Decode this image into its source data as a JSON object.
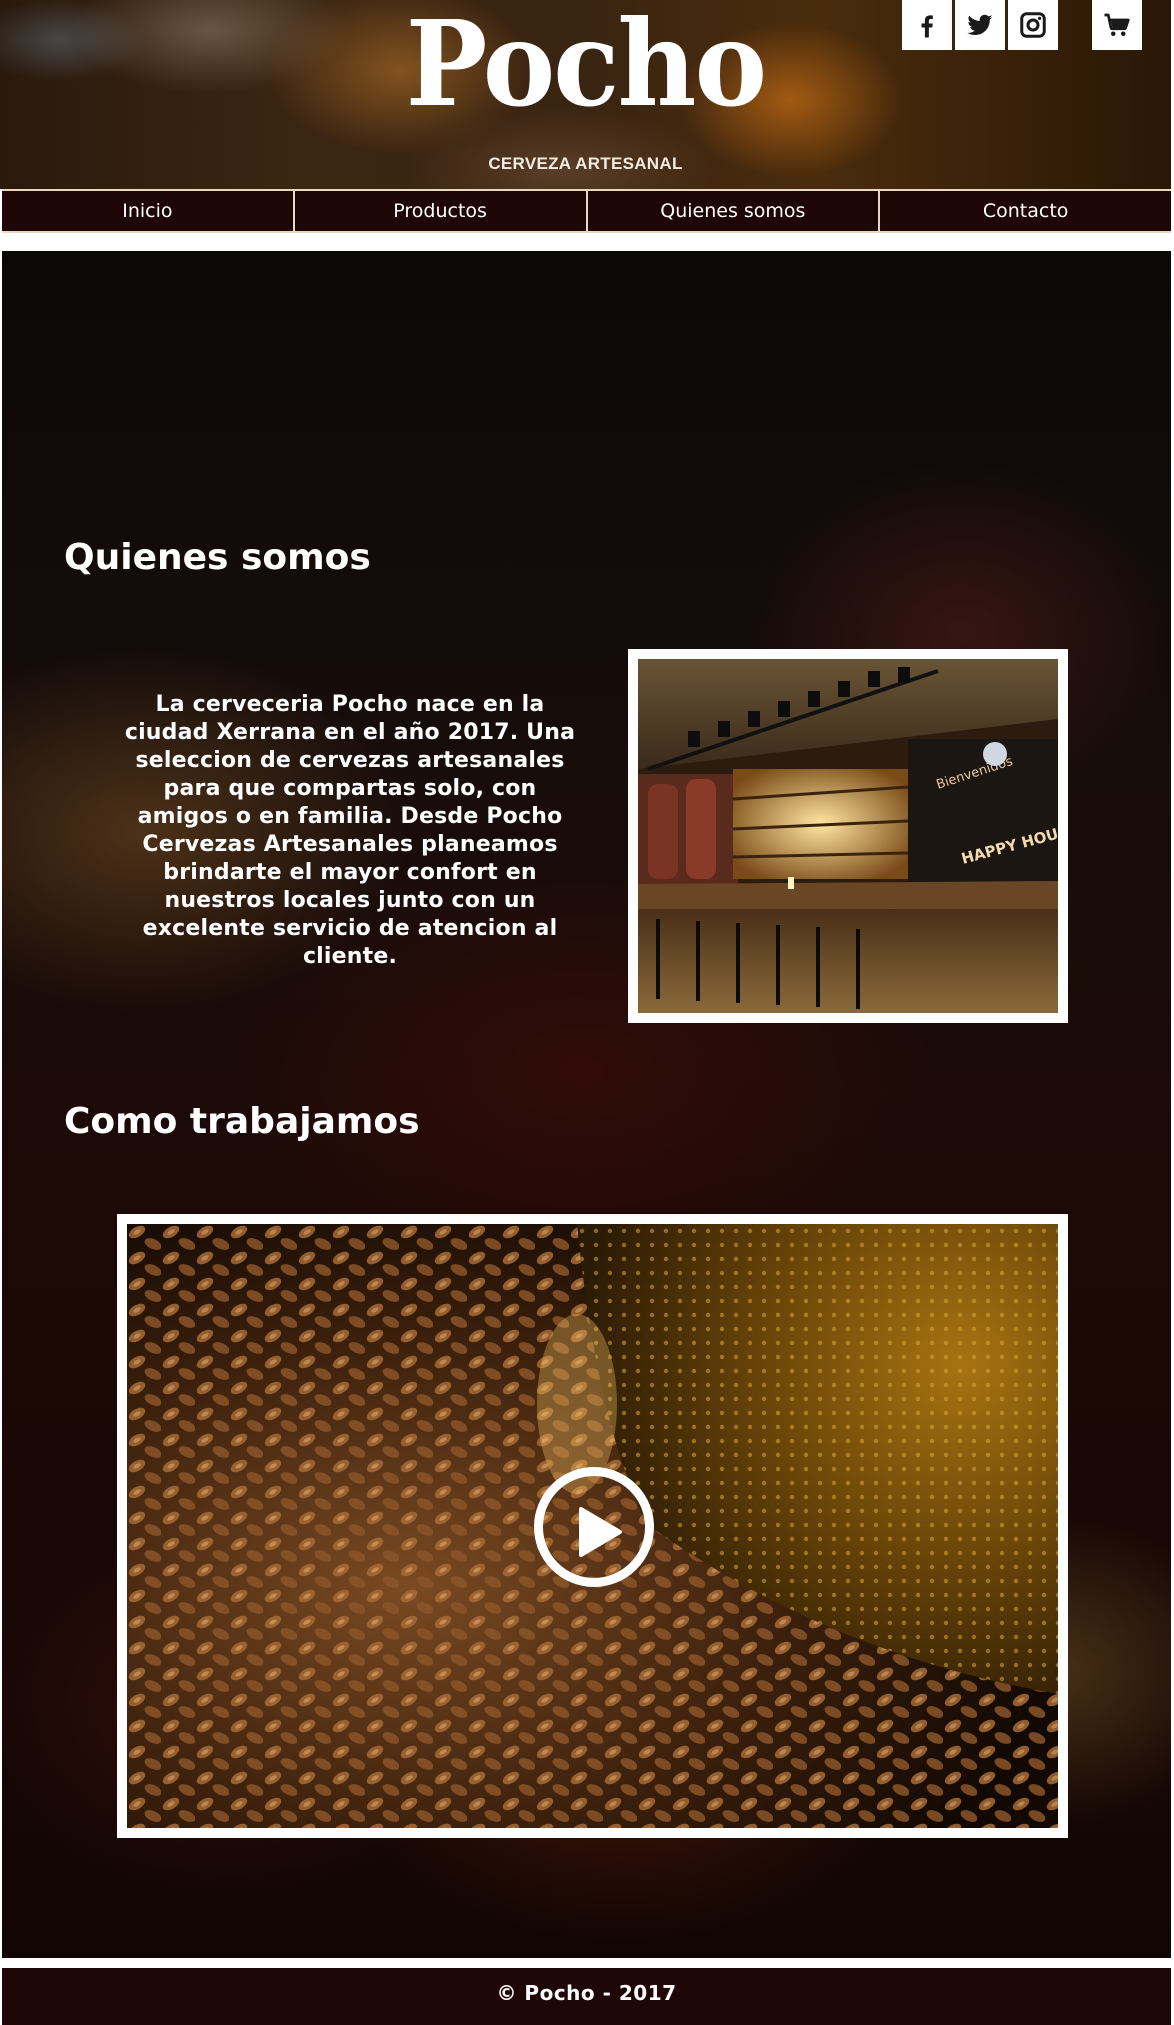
{
  "brand": {
    "name": "Pocho",
    "tagline": "CERVEZA ARTESANAL"
  },
  "header_icons": [
    "facebook-icon",
    "twitter-icon",
    "instagram-icon",
    "cart-icon"
  ],
  "nav": {
    "items": [
      {
        "label": "Inicio"
      },
      {
        "label": "Productos"
      },
      {
        "label": "Quienes somos"
      },
      {
        "label": "Contacto"
      }
    ]
  },
  "about": {
    "title": "Quienes somos",
    "text": "La cerveceria Pocho nace en la ciudad Xerrana en el año 2017. Una seleccion de cervezas artesanales para que compartas solo, con amigos o en familia. Desde Pocho Cervezas Artesanales planeamos brindarte el mayor confort en nuestros locales junto con un excelente servicio de atencion al cliente.",
    "photo_signs": [
      "Bienvenidos",
      "HAPPY HOUR"
    ]
  },
  "work": {
    "title": "Como trabajamos"
  },
  "footer": {
    "copyright": "© Pocho - 2017"
  },
  "colors": {
    "nav_bg": "#1e0606",
    "nav_border": "#e8d8bf",
    "footer_bg": "#1f0707",
    "text": "#ffffff"
  }
}
